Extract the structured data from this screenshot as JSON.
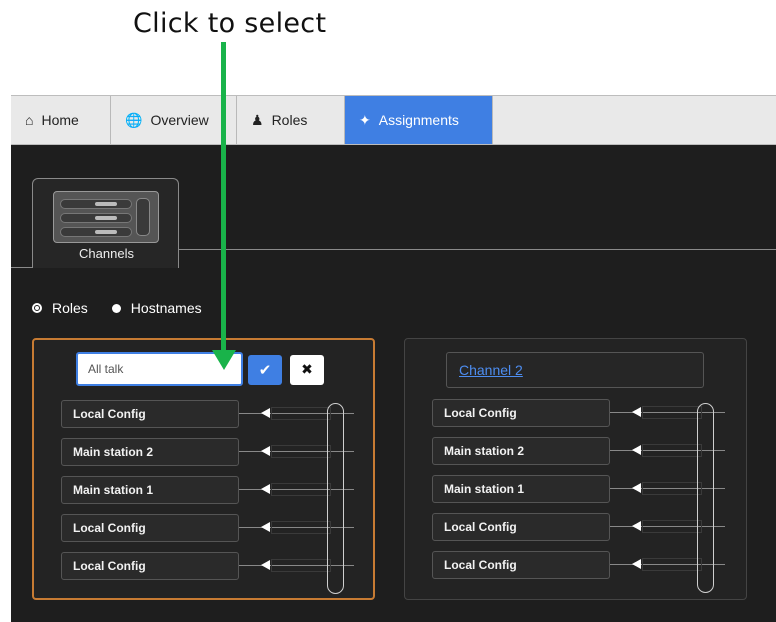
{
  "caption": "Click to select",
  "tabs": [
    {
      "label": "Home",
      "icon": "home-icon"
    },
    {
      "label": "Overview",
      "icon": "globe-icon"
    },
    {
      "label": "Roles",
      "icon": "users-icon"
    },
    {
      "label": "Assignments",
      "icon": "assignments-icon"
    }
  ],
  "active_tab": "Assignments",
  "section_tab": {
    "label": "Channels"
  },
  "radios": [
    {
      "label": "Roles",
      "selected": true
    },
    {
      "label": "Hostnames",
      "selected": false
    }
  ],
  "panel1": {
    "input_value": "All talk",
    "rows": [
      "Local Config",
      "Main station 2",
      "Main station 1",
      "Local Config",
      "Local Config"
    ]
  },
  "panel2": {
    "name": "Channel 2",
    "rows": [
      "Local Config",
      "Main station 2",
      "Main station 1",
      "Local Config",
      "Local Config"
    ]
  },
  "colors": {
    "accent": "#3f7fe3",
    "selection": "#c77b33",
    "annotation": "#19b34a"
  }
}
